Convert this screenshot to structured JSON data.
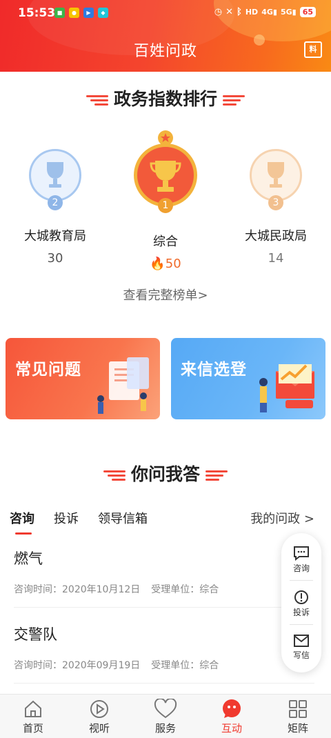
{
  "status": {
    "time": "15:53",
    "battery": "65"
  },
  "header": {
    "title": "百姓问政",
    "news_icon_text": "料"
  },
  "ranking": {
    "title": "政务指数排行",
    "first": {
      "rank": "1",
      "name": "综合",
      "value": "50"
    },
    "second": {
      "rank": "2",
      "name": "大城教育局",
      "value": "30"
    },
    "third": {
      "rank": "3",
      "name": "大城民政局",
      "value": "14"
    },
    "view_all": "查看完整榜单>"
  },
  "banners": {
    "faq": "常见问题",
    "letters": "来信选登"
  },
  "qa": {
    "title": "你问我答",
    "tabs": [
      "咨询",
      "投诉",
      "领导信箱"
    ],
    "my_link": "我的问政 >",
    "items": [
      {
        "title": "燃气",
        "time_label": "咨询时间：2020年10月12日",
        "unit_label": "受理单位：综合"
      },
      {
        "title": "交警队",
        "time_label": "咨询时间：2020年09月19日",
        "unit_label": "受理单位：综合"
      }
    ]
  },
  "float_actions": [
    "咨询",
    "投诉",
    "写信"
  ],
  "bottom_nav": [
    "首页",
    "视听",
    "服务",
    "互动",
    "矩阵"
  ],
  "colors": {
    "accent": "#f03a2f",
    "gold": "#f0a030",
    "silver_blue": "#8fb9ec",
    "bronze": "#f4c79a"
  }
}
